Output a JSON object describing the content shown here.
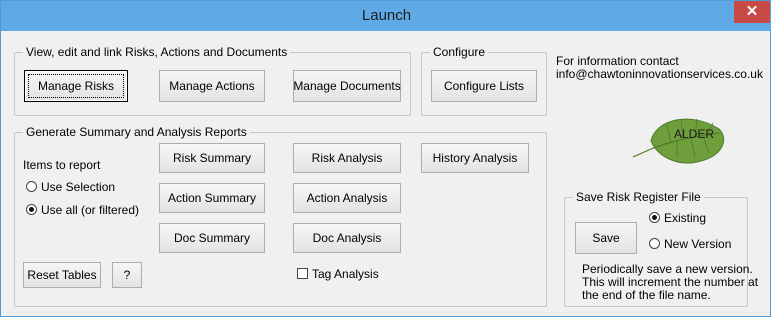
{
  "window": {
    "title": "Launch",
    "close_glyph": "✕"
  },
  "view_group": {
    "legend": "View, edit and link Risks, Actions and Documents",
    "manage_risks": "Manage Risks",
    "manage_actions": "Manage Actions",
    "manage_documents": "Manage Documents"
  },
  "configure_group": {
    "legend": "Configure",
    "configure_lists": "Configure Lists"
  },
  "contact": {
    "line1": "For information contact",
    "line2": "info@chawtoninnovationservices.co.uk"
  },
  "logo": {
    "text": "ALDER",
    "leaf_color": "#6e9f3c",
    "vein_color": "#4f7a27"
  },
  "reports_group": {
    "legend": "Generate Summary and Analysis Reports",
    "items_label": "Items to report",
    "use_selection": "Use Selection",
    "use_all": "Use all (or filtered)",
    "selected_option": "use_all",
    "risk_summary": "Risk Summary",
    "risk_analysis": "Risk Analysis",
    "history_analysis": "History Analysis",
    "action_summary": "Action Summary",
    "action_analysis": "Action Analysis",
    "doc_summary": "Doc Summary",
    "doc_analysis": "Doc Analysis",
    "reset_tables": "Reset Tables",
    "help": "?",
    "tag_analysis": "Tag Analysis",
    "tag_analysis_checked": false
  },
  "save_group": {
    "legend": "Save Risk Register File",
    "save": "Save",
    "existing": "Existing",
    "new_version": "New Version",
    "selected_option": "existing",
    "note_line1": "Periodically save a new version.",
    "note_line2": "This will increment the number at",
    "note_line3": "the end of the file name."
  }
}
